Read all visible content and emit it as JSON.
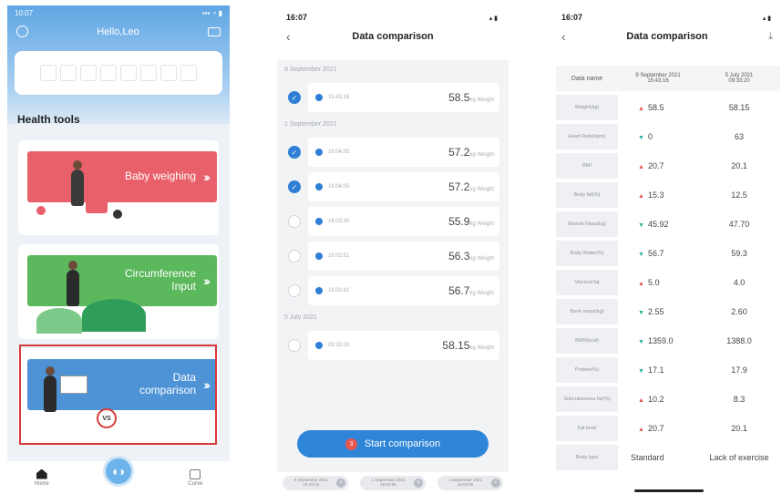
{
  "screen1": {
    "status_time": "10:07",
    "greeting": "Hello,Leo",
    "section_title": "Health tools",
    "tools": [
      {
        "label": "Baby weighing",
        "color": "#e8606a"
      },
      {
        "label": "Circumference Input",
        "color": "#5cb85c"
      },
      {
        "label": "Data comparison",
        "color": "#4d93d6"
      }
    ],
    "vs_badge": "VS",
    "tabs": {
      "home": "Home",
      "curve": "Curve"
    },
    "accent": "#d63a3a"
  },
  "screen2": {
    "status_time": "16:07",
    "title": "Data comparison",
    "groups": [
      {
        "date": "9 September 2021",
        "records": [
          {
            "time": "15:43:16",
            "value": "58.5",
            "unit": "kg Weight",
            "checked": true
          }
        ]
      },
      {
        "date": "1 September 2021",
        "records": [
          {
            "time": "16:04:05",
            "value": "57.2",
            "unit": "kg Weight",
            "checked": true
          },
          {
            "time": "16:04:05",
            "value": "57.2",
            "unit": "kg Weight",
            "checked": true
          },
          {
            "time": "16:03:30",
            "value": "55.9",
            "unit": "kg Weight",
            "checked": false
          },
          {
            "time": "16:02:51",
            "value": "56.3",
            "unit": "kg Weight",
            "checked": false
          },
          {
            "time": "16:02:42",
            "value": "56.7",
            "unit": "kg Weight",
            "checked": false
          }
        ]
      },
      {
        "date": "5 July 2021",
        "records": [
          {
            "time": "09:33:20",
            "value": "58.15",
            "unit": "kg Weight",
            "checked": false
          }
        ]
      }
    ],
    "start_button": "Start comparison",
    "selected_count": "3",
    "chips": [
      {
        "date": "9 September 2021",
        "time": "15:43:16"
      },
      {
        "date": "1 September 2021",
        "time": "16:04:05"
      },
      {
        "date": "1 September 2021",
        "time": "16:04:05"
      }
    ],
    "accent": "#2f86d8"
  },
  "screen3": {
    "status_time": "16:07",
    "title": "Data comparison",
    "columns": {
      "name": "Data name",
      "col1_date": "9 September 2021",
      "col1_time": "15:43:16",
      "col2_date": "5 July 2021",
      "col2_time": "09:33:20"
    },
    "rows": [
      {
        "name": "Weight(kg)",
        "trend": "up",
        "v1": "58.5",
        "v2": "58.15"
      },
      {
        "name": "Heart Rate(bpm)",
        "trend": "down",
        "v1": "0",
        "v2": "63"
      },
      {
        "name": "BMI",
        "trend": "up",
        "v1": "20.7",
        "v2": "20.1"
      },
      {
        "name": "Body fat(%)",
        "trend": "up",
        "v1": "15.3",
        "v2": "12.5"
      },
      {
        "name": "Muscle Mass(kg)",
        "trend": "down",
        "v1": "45.92",
        "v2": "47.70"
      },
      {
        "name": "Body Water(%)",
        "trend": "down",
        "v1": "56.7",
        "v2": "59.3"
      },
      {
        "name": "Visceral fat",
        "trend": "up",
        "v1": "5.0",
        "v2": "4.0"
      },
      {
        "name": "Bone mass(kg)",
        "trend": "down",
        "v1": "2.55",
        "v2": "2.60"
      },
      {
        "name": "BMR(kcal)",
        "trend": "down",
        "v1": "1359.0",
        "v2": "1388.0"
      },
      {
        "name": "Protein(%)",
        "trend": "down",
        "v1": "17.1",
        "v2": "17.9"
      },
      {
        "name": "Subcutaneous fat(%)",
        "trend": "up",
        "v1": "10.2",
        "v2": "8.3"
      },
      {
        "name": "Fat level",
        "trend": "up",
        "v1": "20.7",
        "v2": "20.1"
      },
      {
        "name": "Body type",
        "trend": "",
        "v1": "Standard",
        "v2": "Lack of exercise"
      }
    ],
    "up_color": "#e4574c",
    "down_color": "#25b59c"
  }
}
